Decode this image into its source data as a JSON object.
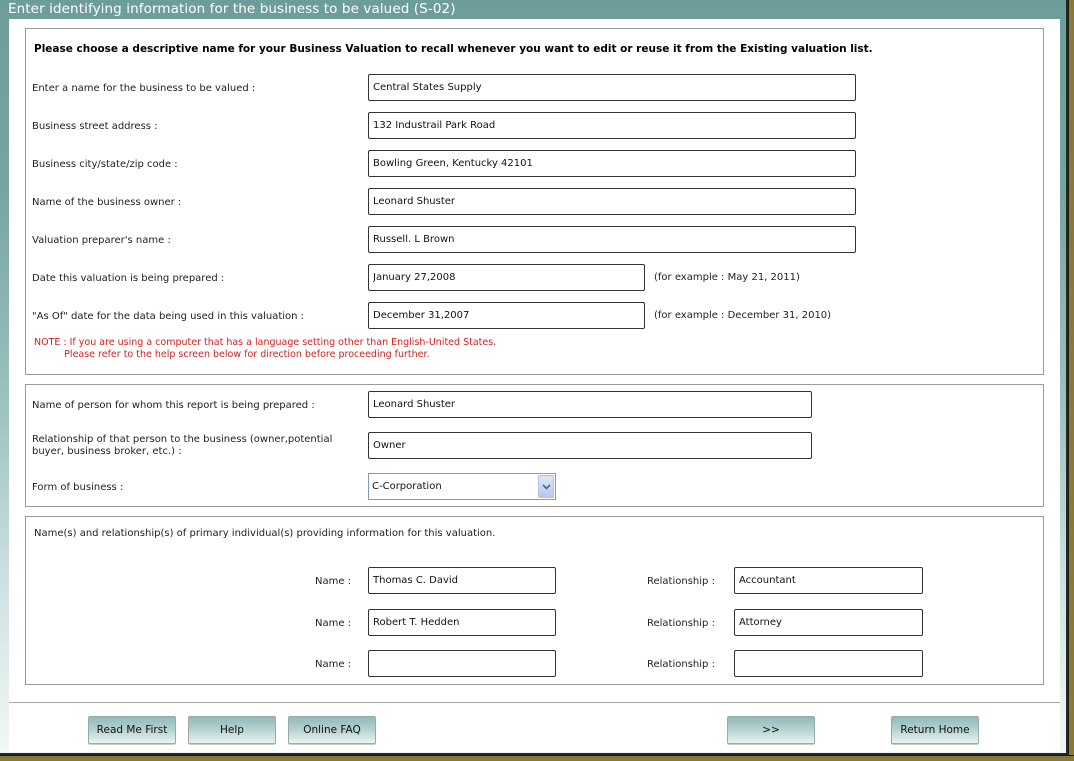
{
  "window": {
    "title": "Enter identifying information for the business to be valued (S-02)"
  },
  "section_business": {
    "instruction": "Please choose a descriptive name for your Business Valuation to recall whenever you want to edit or reuse it from the Existing valuation list.",
    "fields": [
      {
        "label": "Enter a name for the business to be valued :",
        "value": "Central States Supply"
      },
      {
        "label": "Business street address :",
        "value": "132 Industrail Park Road"
      },
      {
        "label": "Business city/state/zip code :",
        "value": "Bowling Green, Kentucky 42101"
      },
      {
        "label": "Name of the business owner :",
        "value": "Leonard Shuster"
      },
      {
        "label": "Valuation preparer's name :",
        "value": "Russell. L Brown"
      },
      {
        "label": "Date this valuation is being prepared :",
        "value": "January 27,2008",
        "hint": "(for example : May 21, 2011)"
      },
      {
        "label": "\"As Of\" date for the data being used in this valuation :",
        "value": "December 31,2007",
        "hint": "(for example : December 31, 2010)"
      }
    ],
    "note_line1": "NOTE : If you are using a computer that has a language setting other than English-United States.",
    "note_line2": "          Please refer to the help screen below for direction before proceeding further."
  },
  "section_report": {
    "fields": [
      {
        "label": "Name of person for whom this report is being prepared :",
        "value": "Leonard Shuster"
      },
      {
        "label_line1": "Relationship of that person to the business (owner,potential",
        "label_line2": "buyer, business broker, etc.) :",
        "value": "Owner"
      }
    ],
    "form_of_business": {
      "label": "Form of business :",
      "selected": "C-Corporation"
    }
  },
  "section_individuals": {
    "heading": "Name(s) and relationship(s) of primary individual(s) providing information for this valuation.",
    "name_label": "Name :",
    "relationship_label": "Relationship :",
    "rows": [
      {
        "name": "Thomas C. David",
        "relationship": "Accountant"
      },
      {
        "name": "Robert T. Hedden",
        "relationship": "Attorney"
      },
      {
        "name": "",
        "relationship": ""
      }
    ]
  },
  "footer": {
    "read_me_first": "Read Me First",
    "help": "Help",
    "online_faq": "Online FAQ",
    "next": ">>",
    "return_home": "Return Home"
  },
  "colors": {
    "title_bar": "#6d9d9b",
    "note_text": "#d42020",
    "button_top": "#8fbab8"
  }
}
